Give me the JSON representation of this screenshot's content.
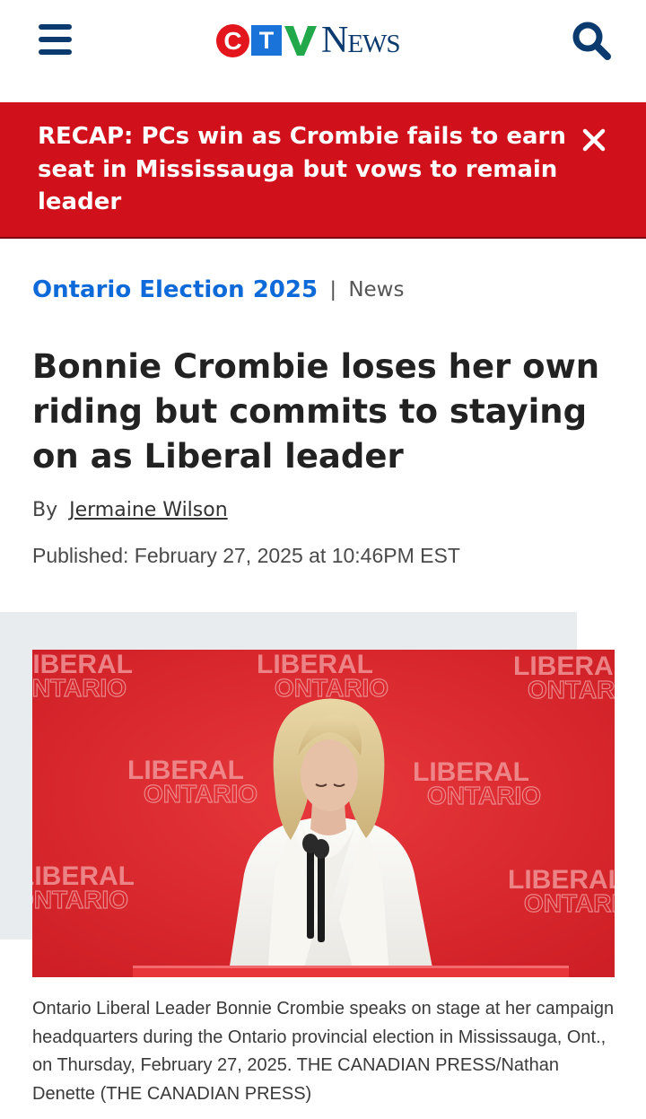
{
  "header": {
    "menu_icon": "hamburger-menu-icon",
    "logo": {
      "c": "C",
      "t": "T",
      "v": "V",
      "news": "News"
    },
    "search_icon": "search-icon",
    "colors": {
      "navy": "#0b3a6e",
      "red": "#e3161d",
      "blue": "#1a73d9",
      "green": "#20a84a"
    }
  },
  "alert": {
    "text": "RECAP: PCs win as Crombie fails to earn seat in Mississauga but vows to remain leader",
    "close_icon": "close-icon",
    "background": "#d0101a"
  },
  "breadcrumb": {
    "section": "Ontario Election 2025",
    "separator": "|",
    "subsection": "News"
  },
  "article": {
    "headline": "Bonnie Crombie loses her own riding but commits to staying on as Liberal leader",
    "by_label": "By",
    "author": "Jermaine Wilson",
    "published": "Published: February 27, 2025 at 10:46PM EST",
    "image": {
      "backdrop_wordmark_1": "LIBERAL",
      "backdrop_wordmark_2": "ONTARIO",
      "description_icon": "photo-icon"
    },
    "caption": "Ontario Liberal Leader Bonnie Crombie speaks on stage at her campaign headquarters during the Ontario provincial election in Mississauga, Ont., on Thursday, February 27, 2025. THE CANADIAN PRESS/Nathan Denette (THE CANADIAN PRESS)"
  }
}
